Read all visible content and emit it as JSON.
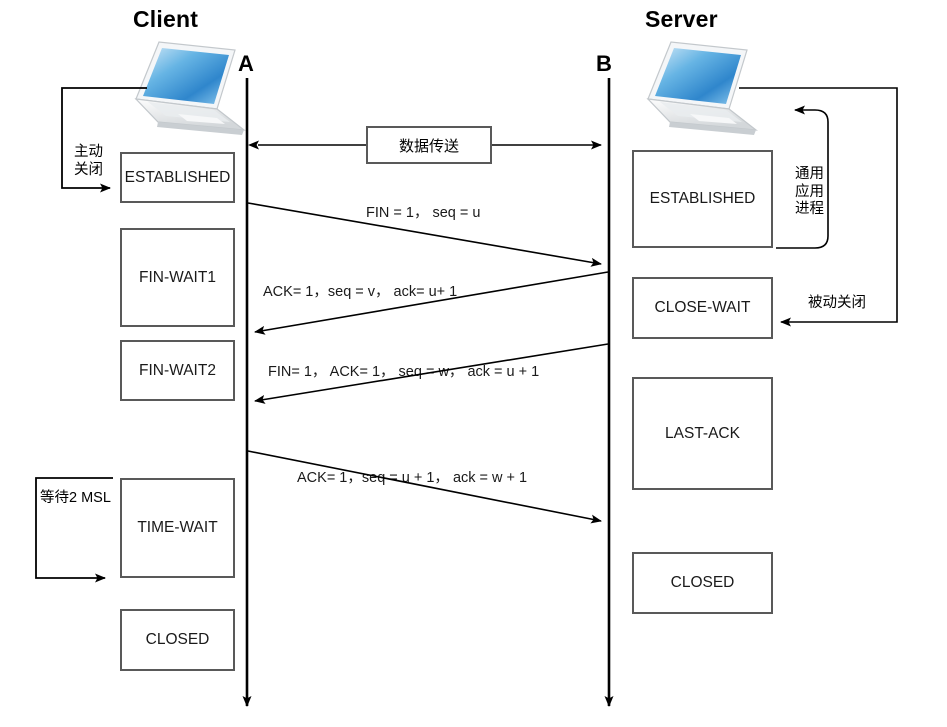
{
  "diagram": {
    "title_client": "Client",
    "title_server": "Server",
    "endpoint_a": "A",
    "endpoint_b": "B",
    "data_transfer_label": "数据传送",
    "active_close_label_line1": "主动",
    "active_close_label_line2": "关闭",
    "passive_close_label": "被动关闭",
    "app_process_label_line1": "通用",
    "app_process_label_line2": "应用",
    "app_process_label_line3": "进程",
    "wait_msl_label": "等待2 MSL"
  },
  "client_states": [
    {
      "name": "ESTABLISHED"
    },
    {
      "name": "FIN-WAIT1"
    },
    {
      "name": "FIN-WAIT2"
    },
    {
      "name": "TIME-WAIT"
    },
    {
      "name": "CLOSED"
    }
  ],
  "server_states": [
    {
      "name": "ESTABLISHED"
    },
    {
      "name": "CLOSE-WAIT"
    },
    {
      "name": "LAST-ACK"
    },
    {
      "name": "CLOSED"
    }
  ],
  "messages": [
    {
      "id": "fin1",
      "text": "FIN = 1，  seq = u",
      "direction": "a-to-b"
    },
    {
      "id": "ack1",
      "text": "ACK= 1，seq = v，  ack= u+ 1",
      "direction": "b-to-a"
    },
    {
      "id": "finack",
      "text": "FIN= 1，  ACK= 1，  seq = w，  ack = u + 1",
      "direction": "b-to-a"
    },
    {
      "id": "ack2",
      "text": "ACK= 1，seq = u + 1，  ack = w + 1",
      "direction": "a-to-b"
    }
  ],
  "colors": {
    "line": "#000000",
    "box_border": "#595959",
    "text": "#1a1a1a",
    "laptop_screen": "#3a93d6",
    "background": "#ffffff"
  }
}
